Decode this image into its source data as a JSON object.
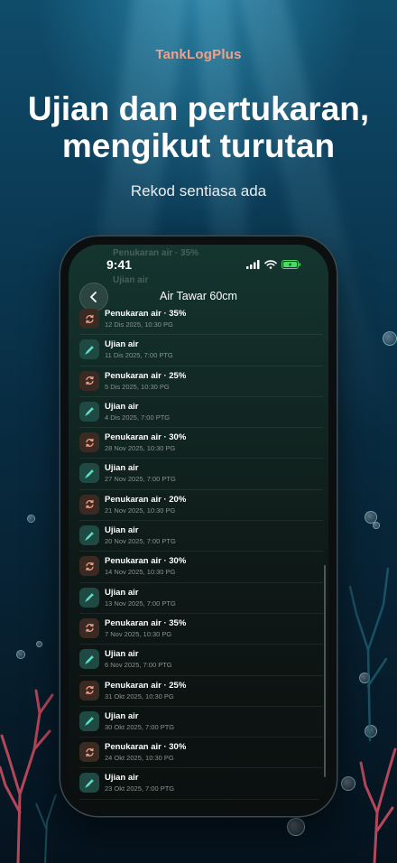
{
  "promo": {
    "brand": "TankLogPlus",
    "headline_line1": "Ujian dan pertukaran,",
    "headline_line2": "mengikut turutan",
    "subline": "Rekod sentiasa ada"
  },
  "status_bar": {
    "time": "9:41",
    "icons": [
      "signal-icon",
      "wifi-icon",
      "battery-charging-icon"
    ],
    "battery_color": "#4cd964"
  },
  "nav": {
    "back_icon": "chevron-left-icon",
    "title": "Air Tawar 60cm"
  },
  "ghost_rows": [
    {
      "title": "Penukaran air · 35%"
    },
    {
      "title": "Ujian air"
    }
  ],
  "colors": {
    "brand": "#f0a18a",
    "test_icon": "#5fe0c4",
    "change_icon": "#f0a18a"
  },
  "records": [
    {
      "type": "change",
      "icon": "refresh-icon",
      "title": "Penukaran air · 35%",
      "date": "12 Dis 2025, 10:30 PG"
    },
    {
      "type": "test",
      "icon": "dropper-icon",
      "title": "Ujian air",
      "date": "11 Dis 2025, 7:00 PTG"
    },
    {
      "type": "change",
      "icon": "refresh-icon",
      "title": "Penukaran air · 25%",
      "date": "5 Dis 2025, 10:30 PG"
    },
    {
      "type": "test",
      "icon": "dropper-icon",
      "title": "Ujian air",
      "date": "4 Dis 2025, 7:00 PTG"
    },
    {
      "type": "change",
      "icon": "refresh-icon",
      "title": "Penukaran air · 30%",
      "date": "28 Nov 2025, 10:30 PG"
    },
    {
      "type": "test",
      "icon": "dropper-icon",
      "title": "Ujian air",
      "date": "27 Nov 2025, 7:00 PTG"
    },
    {
      "type": "change",
      "icon": "refresh-icon",
      "title": "Penukaran air · 20%",
      "date": "21 Nov 2025, 10:30 PG"
    },
    {
      "type": "test",
      "icon": "dropper-icon",
      "title": "Ujian air",
      "date": "20 Nov 2025, 7:00 PTG"
    },
    {
      "type": "change",
      "icon": "refresh-icon",
      "title": "Penukaran air · 30%",
      "date": "14 Nov 2025, 10:30 PG"
    },
    {
      "type": "test",
      "icon": "dropper-icon",
      "title": "Ujian air",
      "date": "13 Nov 2025, 7:00 PTG"
    },
    {
      "type": "change",
      "icon": "refresh-icon",
      "title": "Penukaran air · 35%",
      "date": "7 Nov 2025, 10:30 PG"
    },
    {
      "type": "test",
      "icon": "dropper-icon",
      "title": "Ujian air",
      "date": "6 Nov 2025, 7:00 PTG"
    },
    {
      "type": "change",
      "icon": "refresh-icon",
      "title": "Penukaran air · 25%",
      "date": "31 Okt 2025, 10:30 PG"
    },
    {
      "type": "test",
      "icon": "dropper-icon",
      "title": "Ujian air",
      "date": "30 Okt 2025, 7:00 PTG"
    },
    {
      "type": "change",
      "icon": "refresh-icon",
      "title": "Penukaran air · 30%",
      "date": "24 Okt 2025, 10:30 PG"
    },
    {
      "type": "test",
      "icon": "dropper-icon",
      "title": "Ujian air",
      "date": "23 Okt 2025, 7:00 PTG"
    }
  ]
}
